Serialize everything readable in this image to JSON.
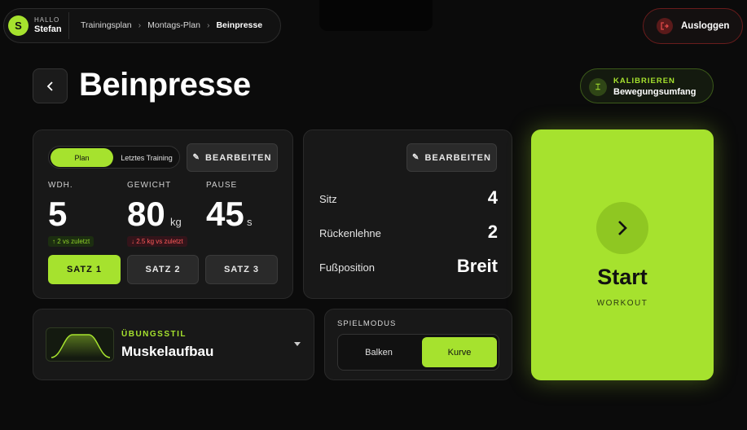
{
  "user": {
    "greeting": "HALLO",
    "name": "Stefan",
    "initial": "S"
  },
  "breadcrumb": {
    "items": [
      "Trainingsplan",
      "Montags-Plan",
      "Beinpresse"
    ],
    "sep": "›"
  },
  "logout_label": "Ausloggen",
  "page_title": "Beinpresse",
  "calibrate": {
    "line1": "KALIBRIEREN",
    "line2": "Bewegungsumfang"
  },
  "plan_card": {
    "tabs": [
      "Plan",
      "Letztes Training"
    ],
    "edit_label": "BEARBEITEN",
    "stats": [
      {
        "label": "WDH.",
        "value": "5",
        "unit": "",
        "delta": "↑ 2 vs zuletzt"
      },
      {
        "label": "GEWICHT",
        "value": "80",
        "unit": "kg",
        "delta": "↓ 2.5 kg vs zuletzt"
      },
      {
        "label": "PAUSE",
        "value": "45",
        "unit": "s"
      }
    ],
    "sets": [
      "SATZ 1",
      "SATZ 2",
      "SATZ 3"
    ]
  },
  "settings_card": {
    "edit_label": "BEARBEITEN",
    "rows": [
      {
        "label": "Sitz",
        "value": "4"
      },
      {
        "label": "Rückenlehne",
        "value": "2"
      },
      {
        "label": "Fußposition",
        "value": "Breit"
      }
    ]
  },
  "start": {
    "label": "Start",
    "sub": "WORKOUT"
  },
  "style": {
    "label": "ÜBUNGSSTIL",
    "value": "Muskelaufbau"
  },
  "gamemode": {
    "label": "SPIELMODUS",
    "options": [
      "Balken",
      "Kurve"
    ],
    "selected": "Kurve"
  },
  "colors": {
    "accent": "#a6e22e",
    "background": "#0b0b0b",
    "logout": "#d33a3a"
  }
}
